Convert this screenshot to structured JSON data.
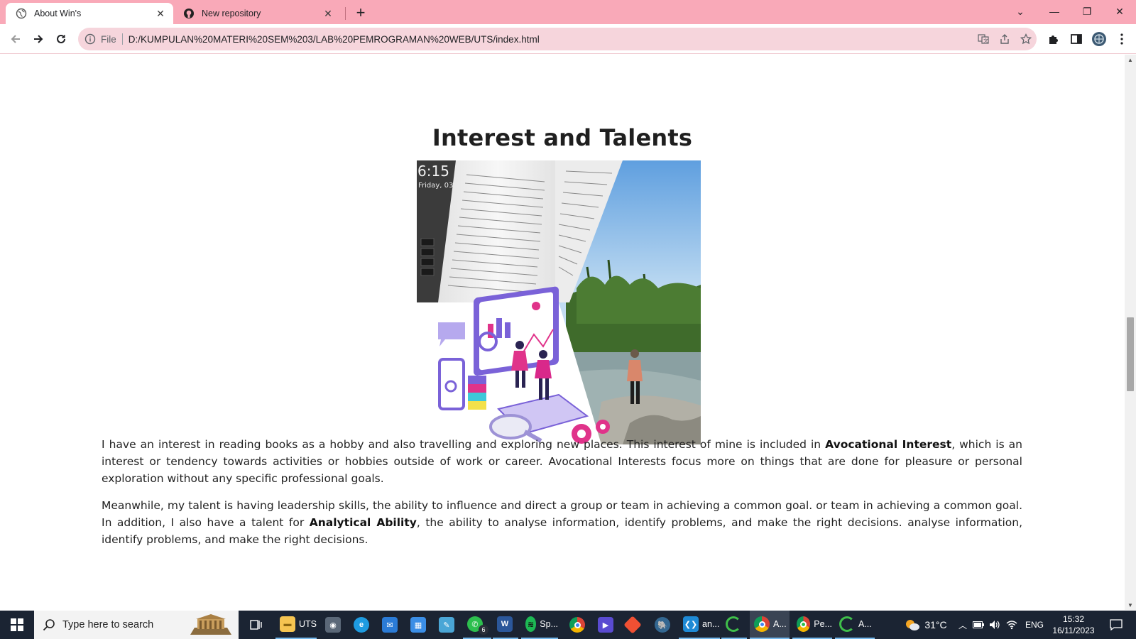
{
  "browser": {
    "tabs": [
      {
        "title": "About Win's",
        "icon": "globe-icon",
        "active": true
      },
      {
        "title": "New repository",
        "icon": "github-icon",
        "active": false
      }
    ],
    "address": {
      "chip": "File",
      "url": "D:/KUMPULAN%20MATERI%20SEM%203/LAB%20PEMROGRAMAN%20WEB/UTS/index.html"
    }
  },
  "page": {
    "section_title": "Interest and Talents",
    "collage": {
      "clock_time": "6:15",
      "clock_date": "Friday, 03",
      "panels": [
        "book-photo",
        "river-landscape-photo",
        "analytics-illustration"
      ]
    },
    "paragraph1": {
      "before": "I have an interest in reading books as a hobby and also travelling and exploring new places. This interest of mine is included in ",
      "bold": "Avocational Interest",
      "after": ", which is an interest or tendency towards activities or hobbies outside of work or career. Avocational Interests focus more on things that are done for pleasure or personal exploration without any specific professional goals."
    },
    "paragraph2": {
      "before": "Meanwhile, my talent is having leadership skills, the ability to influence and direct a group or team in achieving a common goal. or team in achieving a common goal. In addition, I also have a talent for ",
      "bold": "Analytical Ability",
      "after": ", the ability to analyse information, identify problems, and make the right decisions. analyse information, identify problems, and make the right decisions."
    }
  },
  "taskbar": {
    "search_placeholder": "Type here to search",
    "apps": [
      {
        "label": "UTS",
        "icon": "folder-icon"
      },
      {
        "label": "",
        "icon": "camera-icon"
      },
      {
        "label": "",
        "icon": "edge-icon"
      },
      {
        "label": "",
        "icon": "mail-icon"
      },
      {
        "label": "",
        "icon": "store-icon"
      },
      {
        "label": "",
        "icon": "notepad-icon"
      },
      {
        "label": "6",
        "icon": "whatsapp-icon"
      },
      {
        "label": "",
        "icon": "word-icon"
      },
      {
        "label": "Sp...",
        "icon": "spotify-icon"
      },
      {
        "label": "",
        "icon": "chrome-icon"
      },
      {
        "label": "",
        "icon": "media-player-icon"
      },
      {
        "label": "",
        "icon": "git-icon"
      },
      {
        "label": "",
        "icon": "postgres-icon"
      },
      {
        "label": "an...",
        "icon": "vscode-icon"
      },
      {
        "label": "",
        "icon": "loading-ring-icon"
      },
      {
        "label": "A...",
        "icon": "chrome-icon"
      },
      {
        "label": "Pe...",
        "icon": "chrome-whatsapp-icon"
      },
      {
        "label": "A...",
        "icon": "loading-ring-icon"
      }
    ],
    "weather": "31°C",
    "language": "ENG",
    "time": "15:32",
    "date": "16/11/2023"
  },
  "colors": {
    "tabstrip": "#f9a9b8",
    "omnibox": "#f6d5dc",
    "taskbar": "#1b2433"
  }
}
